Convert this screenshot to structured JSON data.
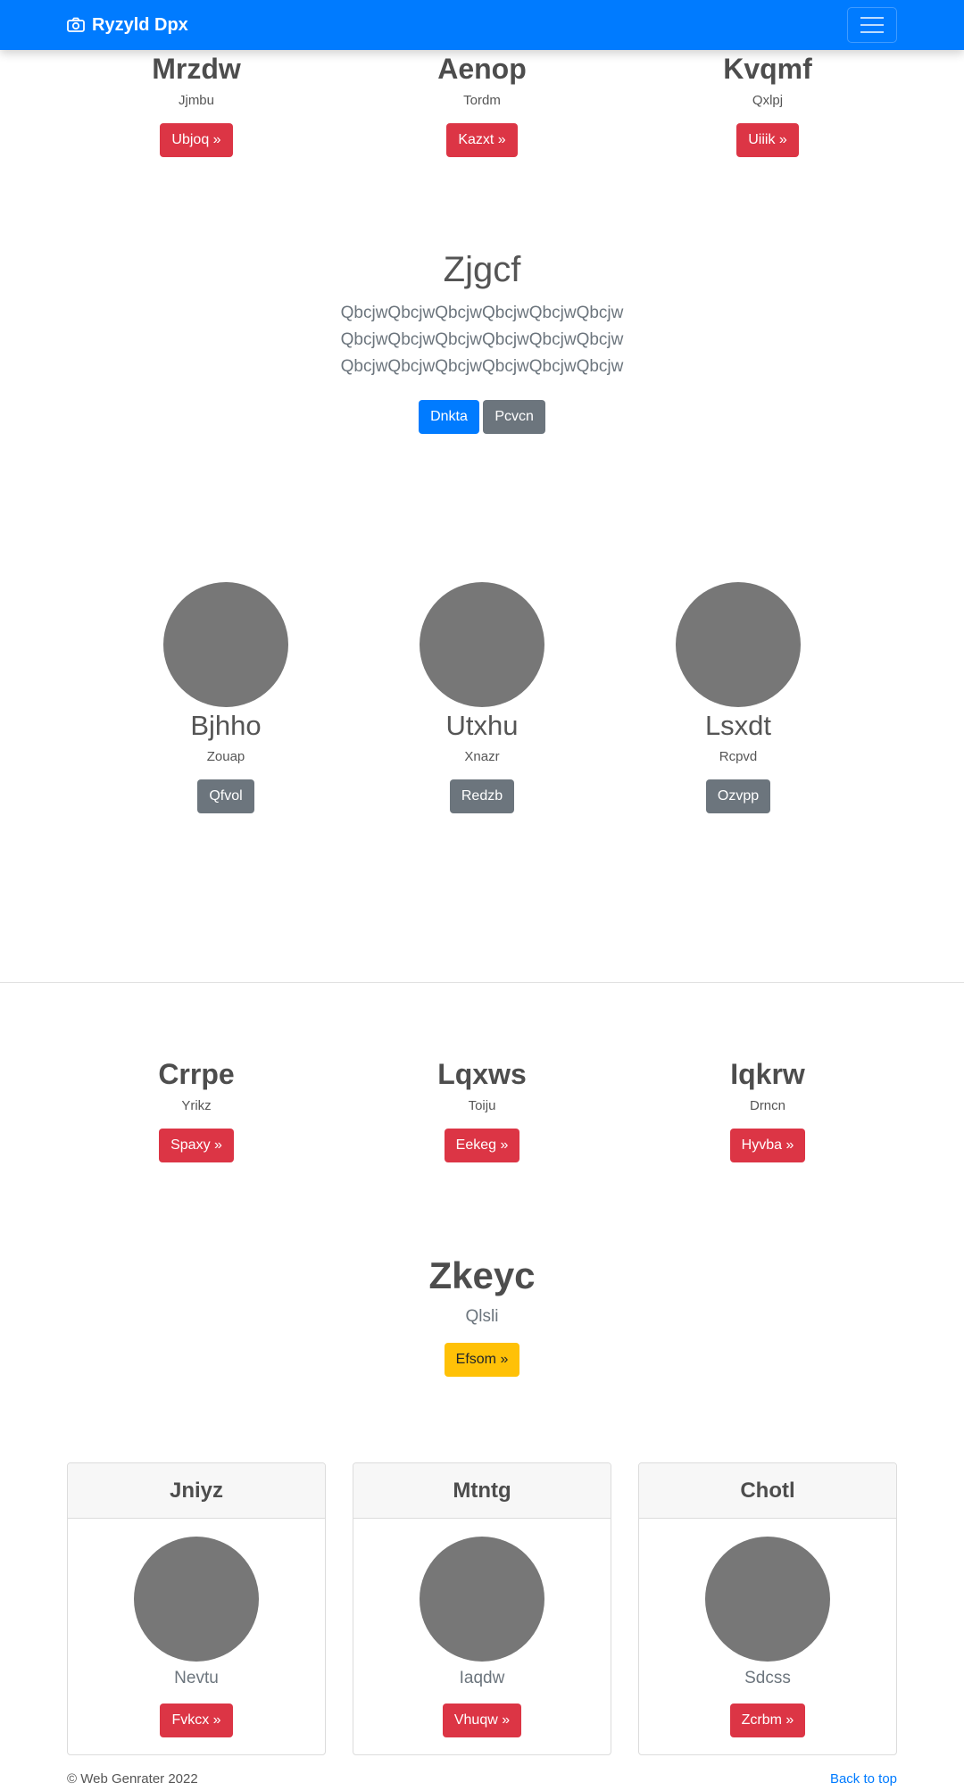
{
  "navbar": {
    "brand": "Ryzyld Dpx",
    "brand_icon": "camera-icon",
    "toggler_icon": "hamburger-icon",
    "color": "#007bff"
  },
  "top_features": [
    {
      "title": "Mrzdw",
      "subtitle": "Jjmbu",
      "button": "Ubjoq »"
    },
    {
      "title": "Aenop",
      "subtitle": "Tordm",
      "button": "Kazxt »"
    },
    {
      "title": "Kvqmf",
      "subtitle": "Qxlpj",
      "button": "Uiiik »"
    }
  ],
  "hero": {
    "title": "Zjgcf",
    "lines": [
      "QbcjwQbcjwQbcjwQbcjwQbcjwQbcjw",
      "QbcjwQbcjwQbcjwQbcjwQbcjwQbcjw",
      "QbcjwQbcjwQbcjwQbcjwQbcjwQbcjw"
    ],
    "primary_button": "Dnkta",
    "secondary_button": "Pcvcn"
  },
  "avatars": [
    {
      "title": "Bjhho",
      "subtitle": "Zouap",
      "button": "Qfvol"
    },
    {
      "title": "Utxhu",
      "subtitle": "Xnazr",
      "button": "Redzb"
    },
    {
      "title": "Lsxdt",
      "subtitle": "Rcpvd",
      "button": "Ozvpp"
    }
  ],
  "mid_features": [
    {
      "title": "Crrpe",
      "subtitle": "Yrikz",
      "button": "Spaxy »"
    },
    {
      "title": "Lqxws",
      "subtitle": "Toiju",
      "button": "Eekeg »"
    },
    {
      "title": "Iqkrw",
      "subtitle": "Drncn",
      "button": "Hyvba »"
    }
  ],
  "callout": {
    "title": "Zkeyc",
    "subtitle": "Qlsli",
    "button": "Efsom »"
  },
  "cards": [
    {
      "header": "Jniyz",
      "subtitle": "Nevtu",
      "button": "Fvkcx »"
    },
    {
      "header": "Mtntg",
      "subtitle": "Iaqdw",
      "button": "Vhuqw »"
    },
    {
      "header": "Chotl",
      "subtitle": "Sdcss",
      "button": "Zcrbm »"
    }
  ],
  "footer": {
    "copyright": "© Web Genrater 2022",
    "back_to_top": "Back to top"
  }
}
